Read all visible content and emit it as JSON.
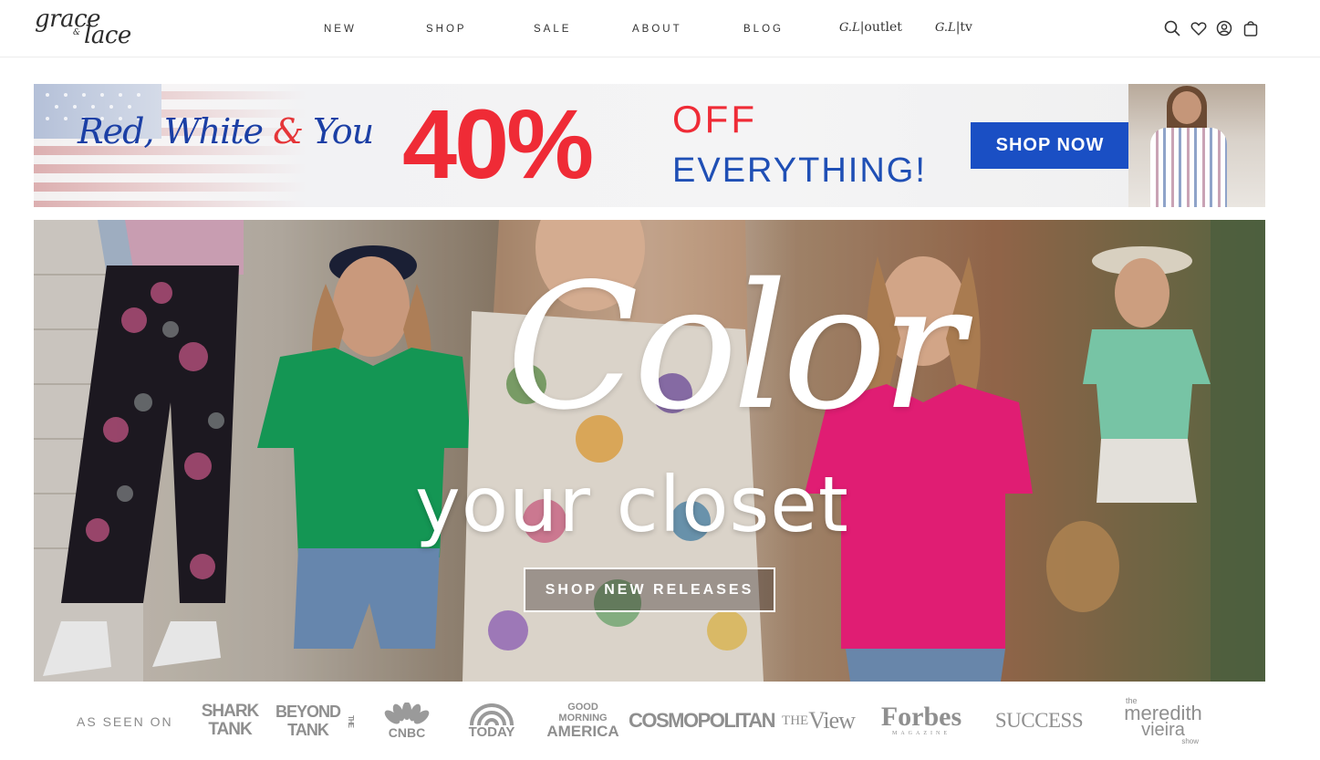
{
  "brand": {
    "logo_line1": "grace",
    "logo_amp": "&",
    "logo_line2": "lace"
  },
  "nav": {
    "items": [
      {
        "label": "NEW"
      },
      {
        "label": "SHOP"
      },
      {
        "label": "SALE"
      },
      {
        "label": "ABOUT"
      },
      {
        "label": "BLOG"
      }
    ],
    "outlet": {
      "mono": "G.L",
      "sep": "|",
      "label": "outlet"
    },
    "tv": {
      "mono": "G.L",
      "sep": "|",
      "label": "tv"
    }
  },
  "header_icons": [
    "search-icon",
    "heart-icon",
    "account-icon",
    "bag-icon"
  ],
  "promo": {
    "script_a": "Red, White ",
    "script_amp": "&",
    "script_b": " You",
    "percent": "40%",
    "off": "OFF",
    "everything": "EVERYTHING!",
    "button": "SHOP NOW",
    "colors": {
      "red": "#ef2b36",
      "blue": "#1a4fc4"
    }
  },
  "hero": {
    "script_title": "Color",
    "subtitle": "your closet",
    "button": "SHOP NEW RELEASES"
  },
  "as_seen_on": {
    "label": "AS SEEN ON",
    "brands": [
      {
        "line1": "SHARK",
        "line2": "TANK"
      },
      {
        "line1": "BEYOND",
        "line2": "TANK",
        "side": "THE"
      },
      {
        "line1": "CNBC"
      },
      {
        "line1": "TODAY"
      },
      {
        "line1": "GOOD",
        "line2": "MORNING",
        "line3": "AMERICA"
      },
      {
        "line1": "COSMOPOLITAN"
      },
      {
        "line1": "THE",
        "line2": "View"
      },
      {
        "line1": "Forbes",
        "line2": "MAGAZINE"
      },
      {
        "line1": "SUCCESS"
      },
      {
        "line1": "the",
        "line2": "meredith",
        "line3": "vieira",
        "line4": "show"
      }
    ]
  }
}
